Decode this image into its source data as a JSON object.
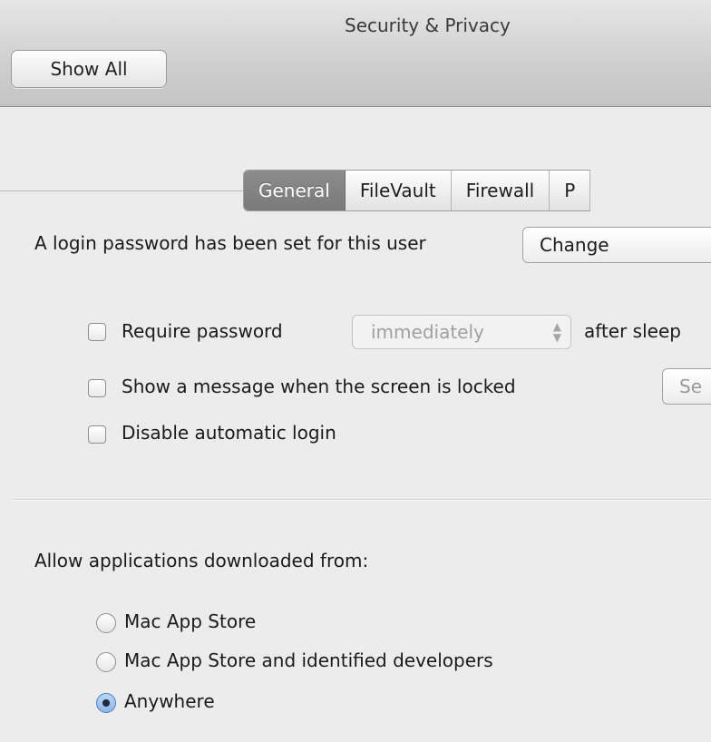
{
  "window": {
    "title": "Security & Privacy"
  },
  "toolbar": {
    "show_all_label": "Show All"
  },
  "tabs": [
    {
      "label": "General",
      "active": true
    },
    {
      "label": "FileVault",
      "active": false
    },
    {
      "label": "Firewall",
      "active": false
    },
    {
      "label": "P",
      "active": false
    }
  ],
  "general": {
    "password_text": "A login password has been set for this user",
    "change_button": "Change",
    "require_password": {
      "label": "Require password",
      "checked": false
    },
    "require_delay": "immediately",
    "after_sleep_text": "after sleep",
    "show_message": {
      "label": "Show a message when the screen is locked",
      "checked": false
    },
    "set_button": "Se",
    "disable_login": {
      "label": "Disable automatic login",
      "checked": false
    }
  },
  "gatekeeper": {
    "heading": "Allow applications downloaded from:",
    "options": [
      {
        "label": "Mac App Store",
        "selected": false
      },
      {
        "label": "Mac App Store and identified developers",
        "selected": false
      },
      {
        "label": "Anywhere",
        "selected": true
      }
    ]
  },
  "icons": {
    "popup_arrows": "up-down-chevron-icon",
    "radio_dot": "radio-dot-icon"
  }
}
